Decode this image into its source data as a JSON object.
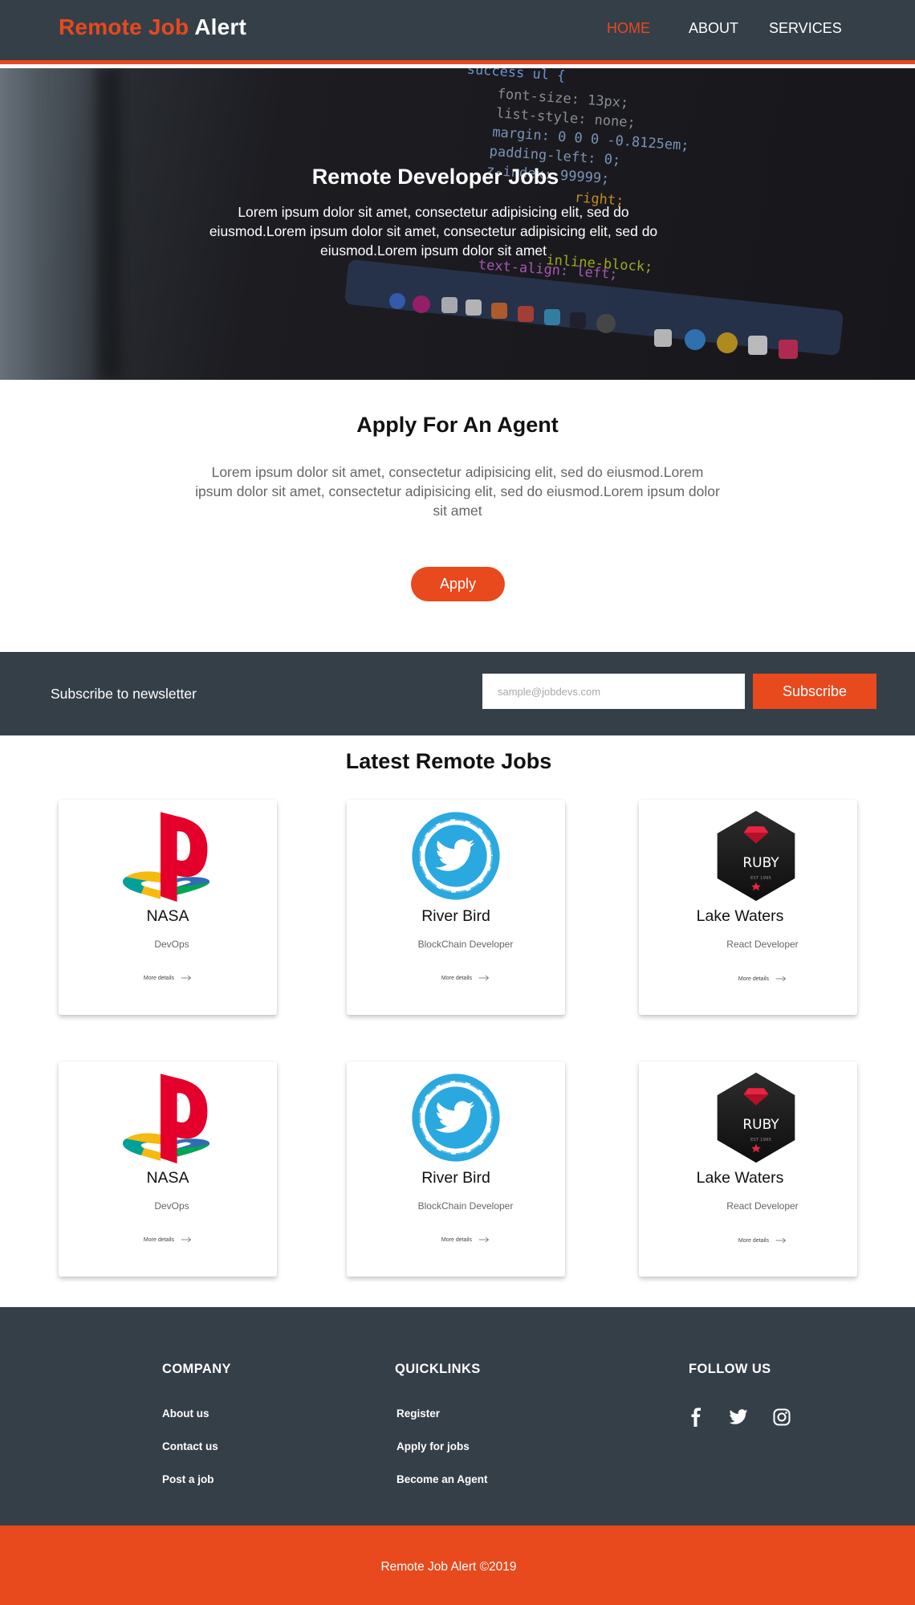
{
  "nav": {
    "brand_part1": "Remote Job",
    "brand_part2": "Alert",
    "links": [
      {
        "label": "HOME",
        "active": true
      },
      {
        "label": "ABOUT",
        "active": false
      },
      {
        "label": "SERVICES",
        "active": false
      }
    ]
  },
  "hero": {
    "title": "Remote  Developer Jobs",
    "text": "Lorem ipsum dolor sit amet, consectetur adipisicing elit, sed do eiusmod.Lorem ipsum dolor sit amet, consectetur adipisicing elit, sed do eiusmod.Lorem ipsum dolor sit amet",
    "code_lines": [
      "success ul {",
      "font-size: 13px;",
      "list-style: none;",
      "margin: 0 0 0 -0.8125em;",
      "padding-left: 0;",
      "z-index: 99999;",
      "right;",
      "inline-block;",
      "text-align: left;"
    ]
  },
  "agent": {
    "title": "Apply For An Agent",
    "text": "Lorem ipsum dolor sit amet, consectetur adipisicing elit, sed do eiusmod.Lorem ipsum dolor sit amet, consectetur adipisicing elit, sed do eiusmod.Lorem ipsum dolor sit amet",
    "button": "Apply"
  },
  "newsletter": {
    "label": "Subscribe to newsletter",
    "placeholder": "sample@jobdevs.com",
    "button": "Subscribe"
  },
  "jobs": {
    "title": "Latest Remote Jobs",
    "cards": [
      {
        "company": "NASA",
        "role": "DevOps",
        "more": "More details",
        "logo": "playstation-logo"
      },
      {
        "company": "River Bird",
        "role": "BlockChain Developer",
        "more": "More details",
        "logo": "twitter-bird-logo"
      },
      {
        "company": "Lake Waters",
        "role": "React Developer",
        "more": "More details",
        "logo": "ruby-hexagon-logo"
      },
      {
        "company": "NASA",
        "role": "DevOps",
        "more": "More details",
        "logo": "playstation-logo"
      },
      {
        "company": "River Bird",
        "role": "BlockChain Developer",
        "more": "More details",
        "logo": "twitter-bird-logo"
      },
      {
        "company": "Lake Waters",
        "role": "React Developer",
        "more": "More details",
        "logo": "ruby-hexagon-logo"
      }
    ],
    "ruby_badge": {
      "word": "RUBY",
      "est": "EST 1995"
    }
  },
  "footer": {
    "company": {
      "heading": "COMPANY",
      "links": [
        "About us",
        "Contact us",
        "Post a job"
      ]
    },
    "quicklinks": {
      "heading": "QUICKLINKS",
      "links": [
        "Register",
        "Apply for jobs",
        "Become an Agent"
      ]
    },
    "follow": {
      "heading": "FOLLOW US",
      "icons": [
        "facebook-icon",
        "twitter-icon",
        "instagram-icon"
      ]
    },
    "copyright": "Remote Job Alert ©2019"
  },
  "colors": {
    "accent": "#e8491d",
    "dark": "#353f48",
    "twitter_blue": "#2aa8e0"
  }
}
